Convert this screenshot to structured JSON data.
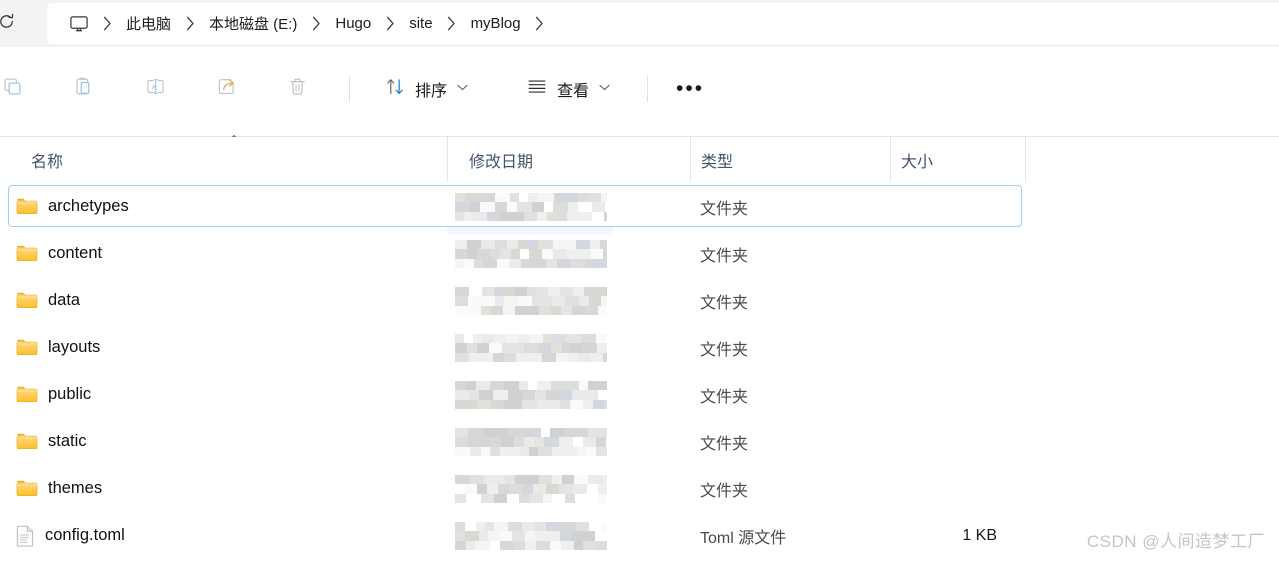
{
  "window": {
    "background": "#ffffff",
    "strip_background": "#f3f3f3",
    "accent": "#0f6cbd",
    "selection_border": "#9ed0f0",
    "folder_color": "#ffc83d",
    "header_text_color": "#44546f"
  },
  "addressbar": {
    "refresh_icon": "refresh-icon",
    "root_icon": "this-pc-monitor-icon",
    "separator": "›",
    "crumbs": [
      {
        "label": "此电脑",
        "name": "breadcrumb-this-pc"
      },
      {
        "label": "本地磁盘 (E:)",
        "name": "breadcrumb-local-disk-e"
      },
      {
        "label": "Hugo",
        "name": "breadcrumb-hugo"
      },
      {
        "label": "site",
        "name": "breadcrumb-site"
      },
      {
        "label": "myBlog",
        "name": "breadcrumb-myblog"
      }
    ]
  },
  "toolbar": {
    "icons": [
      {
        "name": "copy-icon",
        "title": "复制"
      },
      {
        "name": "paste-icon",
        "title": "粘贴"
      },
      {
        "name": "rename-icon",
        "title": "重命名"
      },
      {
        "name": "share-icon",
        "title": "共享"
      },
      {
        "name": "delete-icon",
        "title": "删除"
      }
    ],
    "sort_label": "排序",
    "view_label": "查看",
    "chevron": "⌄",
    "more_label": "•••"
  },
  "columns": {
    "sort_indicator": "⌃",
    "headers": [
      {
        "key": "name",
        "label": "名称"
      },
      {
        "key": "date",
        "label": "修改日期"
      },
      {
        "key": "type",
        "label": "类型"
      },
      {
        "key": "size",
        "label": "大小"
      }
    ]
  },
  "files": [
    {
      "name": "archetypes",
      "icon": "folder-icon",
      "date": "",
      "date_redacted": true,
      "type": "文件夹",
      "size": "",
      "selected": true
    },
    {
      "name": "content",
      "icon": "folder-icon",
      "date": "",
      "date_redacted": true,
      "type": "文件夹",
      "size": "",
      "selected": false
    },
    {
      "name": "data",
      "icon": "folder-icon",
      "date": "",
      "date_redacted": true,
      "type": "文件夹",
      "size": "",
      "selected": false
    },
    {
      "name": "layouts",
      "icon": "folder-icon",
      "date": "",
      "date_redacted": true,
      "type": "文件夹",
      "size": "",
      "selected": false
    },
    {
      "name": "public",
      "icon": "folder-icon",
      "date": "",
      "date_redacted": true,
      "type": "文件夹",
      "size": "",
      "selected": false
    },
    {
      "name": "static",
      "icon": "folder-icon",
      "date": "",
      "date_redacted": true,
      "type": "文件夹",
      "size": "",
      "selected": false
    },
    {
      "name": "themes",
      "icon": "folder-icon",
      "date": "",
      "date_redacted": true,
      "type": "文件夹",
      "size": "",
      "selected": false
    },
    {
      "name": "config.toml",
      "icon": "file-icon",
      "date": "",
      "date_redacted": true,
      "type": "Toml 源文件",
      "size": "1 KB",
      "selected": false
    }
  ],
  "watermark": {
    "text": "CSDN @人间造梦工厂"
  }
}
